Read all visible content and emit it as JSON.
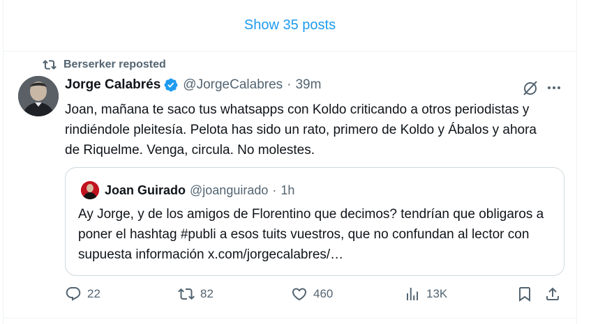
{
  "timeline": {
    "show_posts_label": "Show 35 posts"
  },
  "post": {
    "repost_label": "Berserker reposted",
    "author_name": "Jorge Calabrés",
    "author_handle": "@JorgeCalabres",
    "time": "39m",
    "text": "Joan, mañana te saco tus whatsapps con Koldo criticando a otros periodistas y rindiéndole pleitesía. Pelota has sido un rato, primero de Koldo y Ábalos y ahora de Riquelme. Venga, circula. No molestes.",
    "quote": {
      "author_name": "Joan Guirado",
      "author_handle": "@joanguirado",
      "time": "1h",
      "text": "Ay Jorge, y de los amigos de Florentino que decimos? tendrían que obligaros a poner el hashtag #publi a esos tuits vuestros, que no confundan al lector con supuesta información x.com/jorgecalabres/…"
    },
    "actions": {
      "replies": "22",
      "reposts": "82",
      "likes": "460",
      "views": "13K"
    }
  },
  "colors": {
    "accent": "#1d9bf0",
    "muted": "#536471",
    "text": "#0f1419",
    "border": "#cfd9de"
  }
}
